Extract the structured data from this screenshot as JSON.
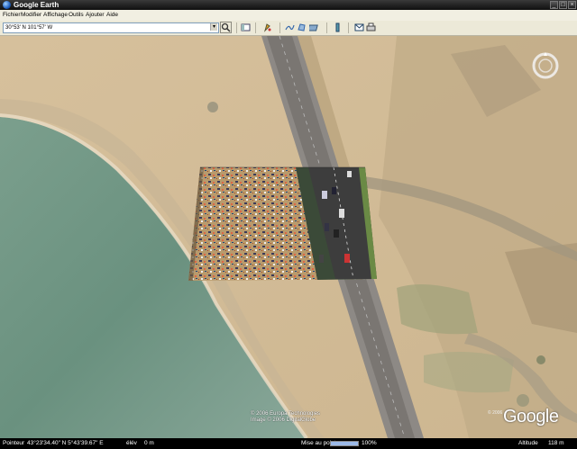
{
  "window": {
    "title": "Google Earth",
    "controls": {
      "minimize": "_",
      "maximize": "□",
      "close": "×"
    }
  },
  "menu": [
    "Fichier",
    "Modifier",
    "Affichage",
    "Outils",
    "Ajouter",
    "Aide"
  ],
  "toolbar": {
    "search_value": "30°53' N 101°57' W",
    "dropdown": "▾",
    "search_icon": "magnifier-icon",
    "icons": [
      "sidebar-icon",
      "path-icon",
      "placemark-icon",
      "polygon-icon",
      "overlay-icon",
      "ruler-icon",
      "email-icon",
      "print-icon"
    ]
  },
  "map": {
    "copyright_line1": "© 2006 Europa Technologies",
    "copyright_line2": "Image © 2006 DigitalGlobe",
    "copyright_corner": "© 2006",
    "logo": "Google"
  },
  "status": {
    "pointer_label": "Pointeur",
    "pointer_value": "43°23'34.40\" N   5°43'39.67\" E",
    "elev_label": "élév",
    "elev_value": "0 m",
    "streaming_label": "Mise au point",
    "streaming_percent": "100%",
    "streaming_fraction": 1.0,
    "altitude_label": "Altitude",
    "altitude_value": "118 m"
  },
  "colors": {
    "water": "#5f8a7a",
    "sand": "#d9c3a0",
    "road": "#8f8a84",
    "overlay_crowd": "#b79a6e"
  }
}
